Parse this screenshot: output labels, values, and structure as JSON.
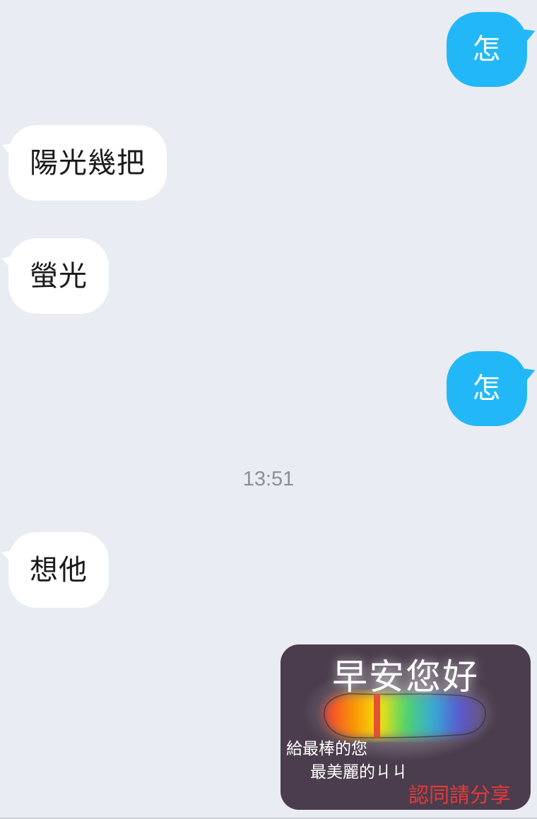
{
  "messages": [
    {
      "direction": "outgoing",
      "text": "怎"
    },
    {
      "direction": "incoming",
      "text": "陽光幾把"
    },
    {
      "direction": "incoming",
      "text": "螢光"
    },
    {
      "direction": "outgoing",
      "text": "怎"
    },
    {
      "direction": "incoming",
      "text": "想他"
    }
  ],
  "timestamp": "13:51",
  "sticker": {
    "title": "早安您好",
    "line1": "給最棒的您",
    "line2": "最美麗的ㄐㄐ",
    "share": "認同請分享"
  },
  "colors": {
    "background": "#e9ecf2",
    "incoming_bubble": "#ffffff",
    "outgoing_bubble": "#22b8f7",
    "sticker_background": "#4b3d4d",
    "sticker_share_text": "#e23b3b"
  }
}
